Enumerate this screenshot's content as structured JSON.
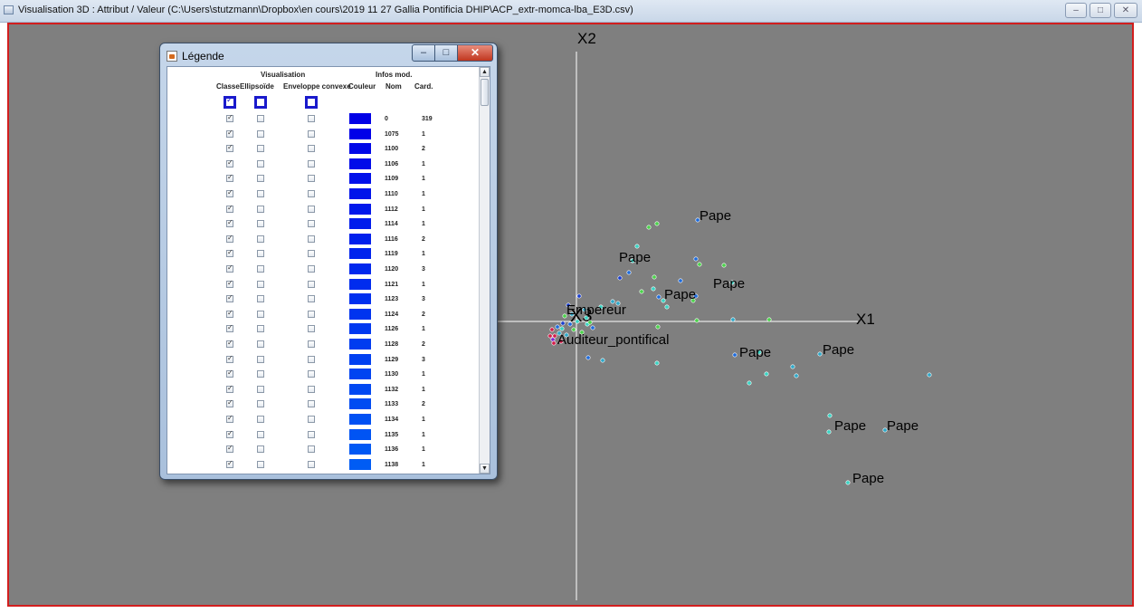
{
  "window": {
    "title": "Visualisation 3D : Attribut / Valeur (C:\\Users\\stutzmann\\Dropbox\\en cours\\2019 11 27 Gallia Pontificia DHIP\\ACP_extr-momca-lba_E3D.csv)",
    "minimize_icon": "minimize-icon",
    "maximize_icon": "maximize-icon",
    "close_icon": "close-icon"
  },
  "plot": {
    "background": "#7f7f7f",
    "border_color": "#d21e1e",
    "axes": {
      "x1": "X1",
      "x2": "X2",
      "x3": "X3"
    },
    "labels": [
      "Pape",
      "Pape",
      "Pape",
      "Pape",
      "Pape",
      "Pape",
      "Pape",
      "Pape",
      "Pape",
      "Empereur",
      "Auditeur_pontifical"
    ],
    "point_colors": [
      "#1e6bdc",
      "#2ea8c8",
      "#39d3c3",
      "#4cd24c",
      "#1a3fd0",
      "#d21e4a",
      "#7c2ad0"
    ]
  },
  "legend": {
    "title": "Légende",
    "group_headers": {
      "visualisation": "Visualisation",
      "infos": "Infos mod."
    },
    "columns": {
      "classe": "Classe",
      "ellipsoide": "Ellipsoïde",
      "enveloppe": "Enveloppe convexe",
      "couleur": "Couleur",
      "nom": "Nom",
      "card": "Card."
    },
    "header_checks": {
      "classe": true,
      "ellipsoide": false,
      "enveloppe": false
    },
    "rows": [
      {
        "nom": "0",
        "card": "319",
        "color": "#0000e6",
        "classe": true,
        "ellipsoide": false,
        "enveloppe": false
      },
      {
        "nom": "1075",
        "card": "1",
        "color": "#0000e8",
        "classe": true,
        "ellipsoide": false,
        "enveloppe": false
      },
      {
        "nom": "1100",
        "card": "2",
        "color": "#0008e8",
        "classe": true,
        "ellipsoide": false,
        "enveloppe": false
      },
      {
        "nom": "1106",
        "card": "1",
        "color": "#000ce9",
        "classe": true,
        "ellipsoide": false,
        "enveloppe": false
      },
      {
        "nom": "1109",
        "card": "1",
        "color": "#0010ea",
        "classe": true,
        "ellipsoide": false,
        "enveloppe": false
      },
      {
        "nom": "1110",
        "card": "1",
        "color": "#0014ea",
        "classe": true,
        "ellipsoide": false,
        "enveloppe": false
      },
      {
        "nom": "1112",
        "card": "1",
        "color": "#0018eb",
        "classe": true,
        "ellipsoide": false,
        "enveloppe": false
      },
      {
        "nom": "1114",
        "card": "1",
        "color": "#001cec",
        "classe": true,
        "ellipsoide": false,
        "enveloppe": false
      },
      {
        "nom": "1116",
        "card": "2",
        "color": "#0020ec",
        "classe": true,
        "ellipsoide": false,
        "enveloppe": false
      },
      {
        "nom": "1119",
        "card": "1",
        "color": "#0024ed",
        "classe": true,
        "ellipsoide": false,
        "enveloppe": false
      },
      {
        "nom": "1120",
        "card": "3",
        "color": "#0028ed",
        "classe": true,
        "ellipsoide": false,
        "enveloppe": false
      },
      {
        "nom": "1121",
        "card": "1",
        "color": "#002cee",
        "classe": true,
        "ellipsoide": false,
        "enveloppe": false
      },
      {
        "nom": "1123",
        "card": "3",
        "color": "#0030ef",
        "classe": true,
        "ellipsoide": false,
        "enveloppe": false
      },
      {
        "nom": "1124",
        "card": "2",
        "color": "#0034ef",
        "classe": true,
        "ellipsoide": false,
        "enveloppe": false
      },
      {
        "nom": "1126",
        "card": "1",
        "color": "#0038f0",
        "classe": true,
        "ellipsoide": false,
        "enveloppe": false
      },
      {
        "nom": "1128",
        "card": "2",
        "color": "#003cf0",
        "classe": true,
        "ellipsoide": false,
        "enveloppe": false
      },
      {
        "nom": "1129",
        "card": "3",
        "color": "#0040f1",
        "classe": true,
        "ellipsoide": false,
        "enveloppe": false
      },
      {
        "nom": "1130",
        "card": "1",
        "color": "#0044f1",
        "classe": true,
        "ellipsoide": false,
        "enveloppe": false
      },
      {
        "nom": "1132",
        "card": "1",
        "color": "#0048f2",
        "classe": true,
        "ellipsoide": false,
        "enveloppe": false
      },
      {
        "nom": "1133",
        "card": "2",
        "color": "#004cf2",
        "classe": true,
        "ellipsoide": false,
        "enveloppe": false
      },
      {
        "nom": "1134",
        "card": "1",
        "color": "#0050f3",
        "classe": true,
        "ellipsoide": false,
        "enveloppe": false
      },
      {
        "nom": "1135",
        "card": "1",
        "color": "#0054f3",
        "classe": true,
        "ellipsoide": false,
        "enveloppe": false
      },
      {
        "nom": "1136",
        "card": "1",
        "color": "#0058f4",
        "classe": true,
        "ellipsoide": false,
        "enveloppe": false
      },
      {
        "nom": "1138",
        "card": "1",
        "color": "#005cf4",
        "classe": true,
        "ellipsoide": false,
        "enveloppe": false
      }
    ]
  }
}
